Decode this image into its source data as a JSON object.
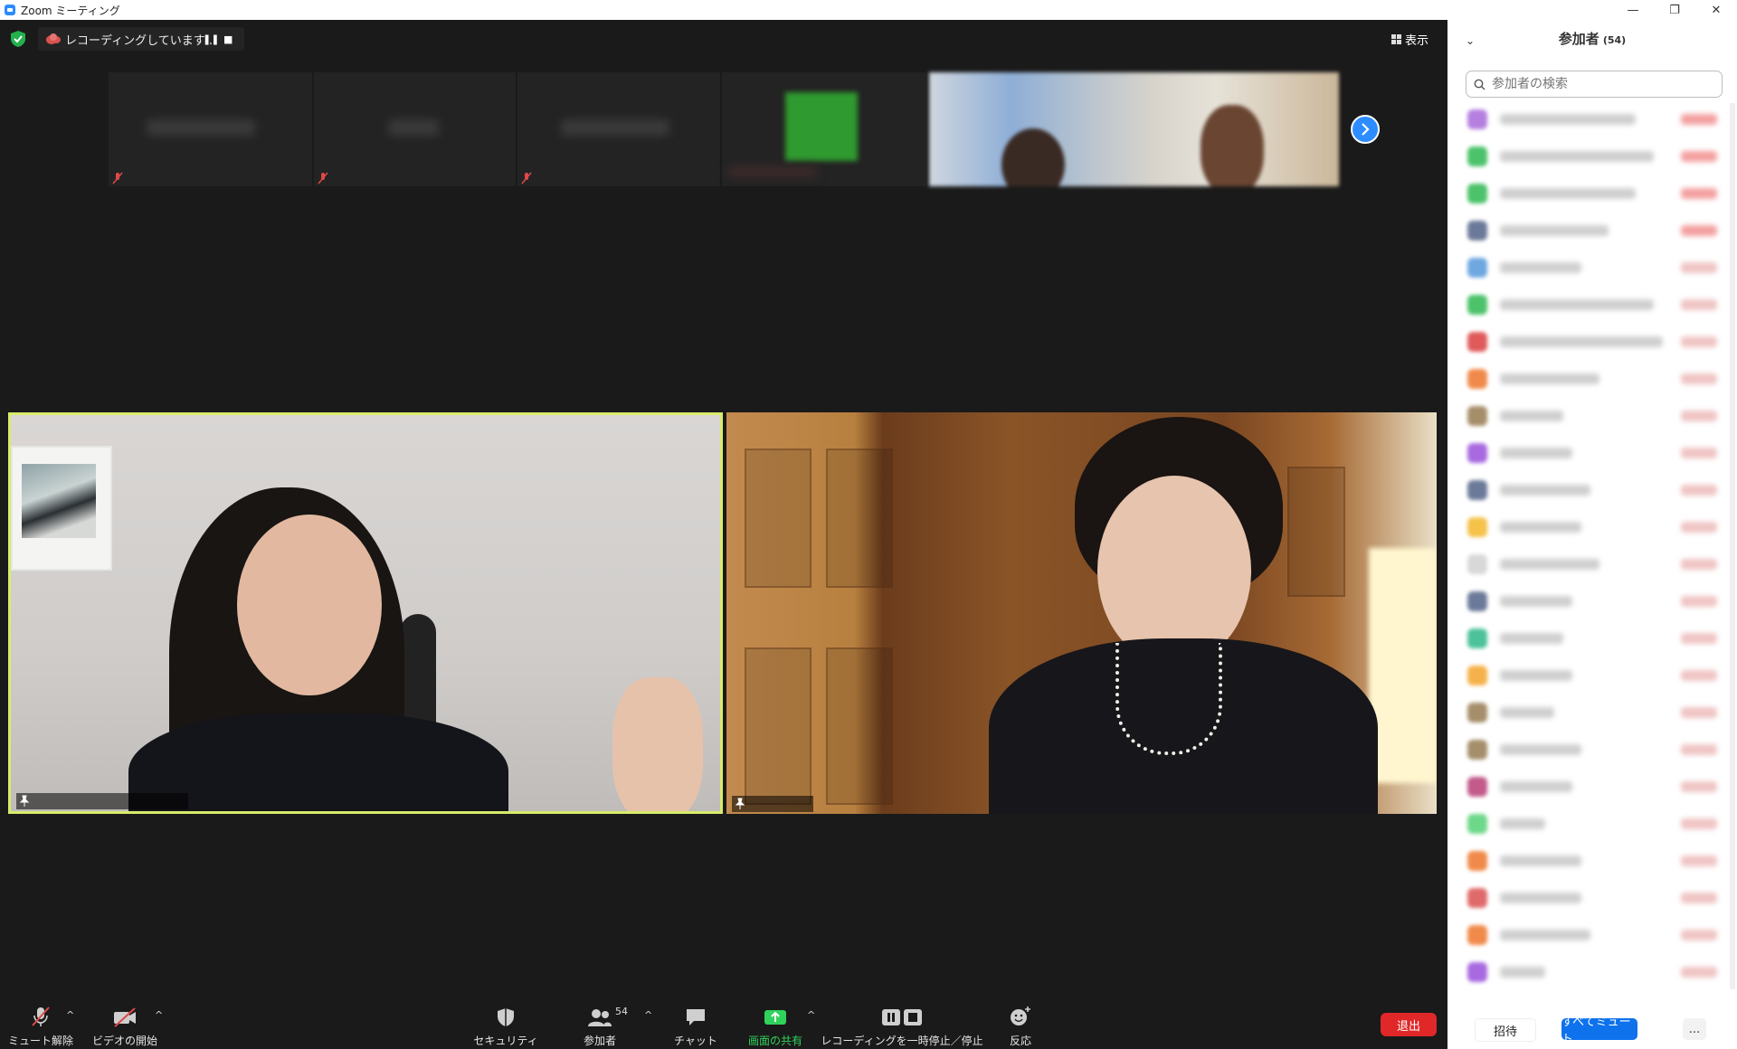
{
  "window": {
    "title": "Zoom ミーティング",
    "controls": [
      "—",
      "❐",
      "✕"
    ]
  },
  "meeting": {
    "recording_status": "レコーディングしています...",
    "view_label": "表示",
    "participants_strip": [
      {
        "muted": true,
        "blurred": true
      },
      {
        "muted": true,
        "blurred": true
      },
      {
        "muted": true,
        "blurred": true
      },
      {
        "muted": false,
        "blurred": true,
        "avatar_color": "#2f9a2f"
      }
    ]
  },
  "toolbar": {
    "unmute": "ミュート解除",
    "start_video": "ビデオの開始",
    "security": "セキュリティ",
    "participants": "参加者",
    "participant_count": "54",
    "chat": "チャット",
    "share_screen": "画面の共有",
    "recording_control": "レコーディングを一時停止／停止",
    "reactions": "反応",
    "leave": "退出"
  },
  "panel": {
    "title": "参加者",
    "count": "(54)",
    "search_placeholder": "参加者の検索",
    "avatar_colors": [
      "#b57fe0",
      "#4cc26b",
      "#4cc26b",
      "#6b7a99",
      "#6fa8e0",
      "#4cc26b",
      "#e05a5a",
      "#f08a4a",
      "#a58e6a",
      "#a86ae0",
      "#6b7a99",
      "#f5c24a",
      "#d8d8d8",
      "#6b7a99",
      "#4cc29a",
      "#f5b24a",
      "#a58e6a",
      "#a58e6a",
      "#c25a8a",
      "#6ed88a",
      "#f08a4a",
      "#e06a6a",
      "#f08a4a",
      "#a86ae0"
    ],
    "footer": {
      "invite": "招待",
      "mute_all": "すべてミュート",
      "more": "..."
    }
  },
  "colors": {
    "accent": "#2d8cff",
    "active_speaker_border": "#d8ec6a",
    "leave": "#e02828",
    "share_green": "#2fd25a",
    "mute_all": "#0e72ed"
  }
}
